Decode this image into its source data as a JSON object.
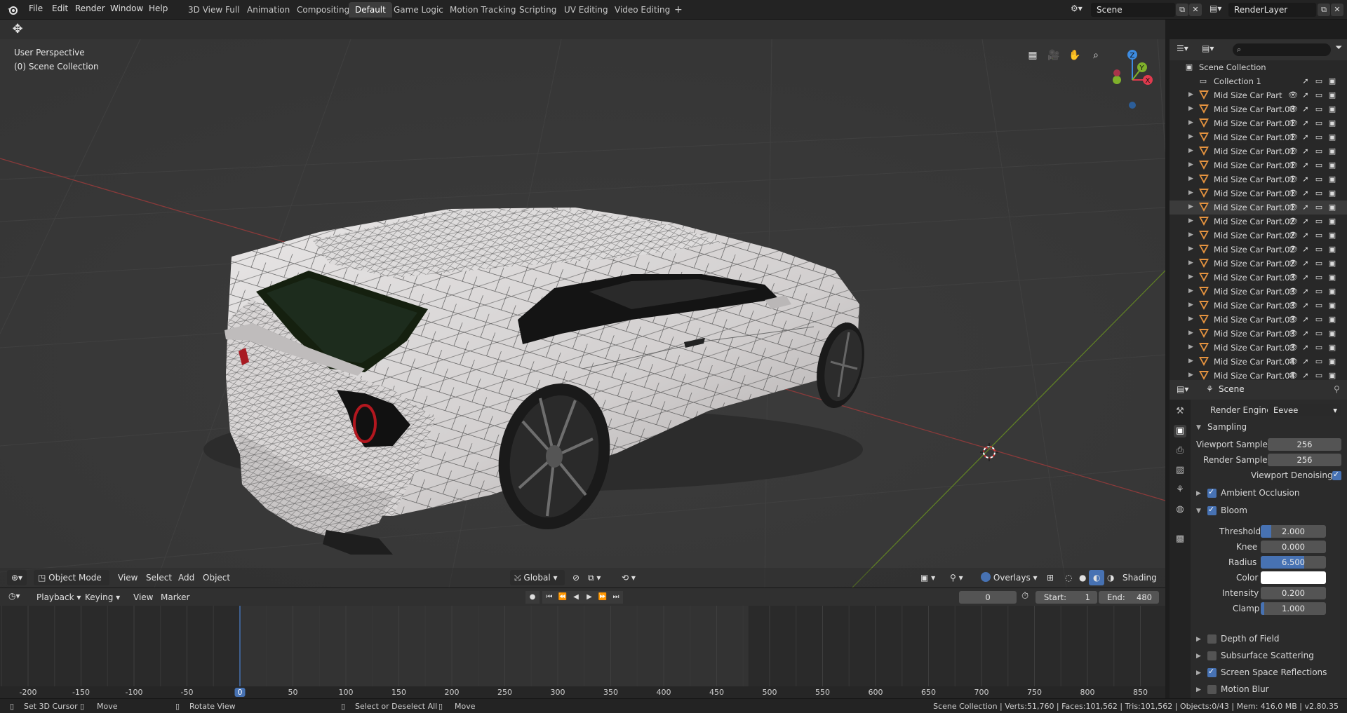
{
  "topbar": {
    "menus": [
      "File",
      "Edit",
      "Render",
      "Window",
      "Help"
    ],
    "workspaces": [
      "3D View Full",
      "Animation",
      "Compositing",
      "Default",
      "Game Logic",
      "Motion Tracking",
      "Scripting",
      "UV Editing",
      "Video Editing"
    ],
    "active_workspace": "Default",
    "add_tab": "+",
    "scene_field": "Scene",
    "layer_field": "RenderLayer"
  },
  "viewport": {
    "perspective_label": "User Perspective",
    "collection_label": "(0) Scene Collection",
    "gizmo": {
      "x": "X",
      "y": "Y",
      "z": "Z"
    },
    "header": {
      "mode": "Object Mode",
      "menus": [
        "View",
        "Select",
        "Add",
        "Object"
      ],
      "orientation": "Global",
      "overlays": "Overlays",
      "shading": "Shading"
    }
  },
  "outliner": {
    "root": "Scene Collection",
    "collection": "Collection 1",
    "items": [
      "Mid Size Car Part",
      "Mid Size Car Part.00",
      "Mid Size Car Part.01",
      "Mid Size Car Part.01",
      "Mid Size Car Part.01",
      "Mid Size Car Part.01",
      "Mid Size Car Part.01",
      "Mid Size Car Part.01",
      "Mid Size Car Part.01",
      "Mid Size Car Part.02",
      "Mid Size Car Part.02",
      "Mid Size Car Part.02",
      "Mid Size Car Part.02",
      "Mid Size Car Part.03",
      "Mid Size Car Part.03",
      "Mid Size Car Part.03",
      "Mid Size Car Part.03",
      "Mid Size Car Part.03",
      "Mid Size Car Part.03",
      "Mid Size Car Part.04",
      "Mid Size Car Part.04"
    ],
    "selected_index": 8
  },
  "properties": {
    "context": "Scene",
    "render_engine_label": "Render Engine",
    "render_engine": "Eevee",
    "sampling": "Sampling",
    "viewport_samples_label": "Viewport Samples",
    "viewport_samples": "256",
    "render_samples_label": "Render Samples",
    "render_samples": "256",
    "viewport_denoising": "Viewport Denoising",
    "ambient_occlusion": "Ambient Occlusion",
    "bloom": "Bloom",
    "threshold_label": "Threshold",
    "threshold": "2.000",
    "knee_label": "Knee",
    "knee": "0.000",
    "radius_label": "Radius",
    "radius": "6.500",
    "color_label": "Color",
    "intensity_label": "Intensity",
    "intensity": "0.200",
    "clamp_label": "Clamp",
    "clamp": "1.000",
    "depth_of_field": "Depth of Field",
    "subsurface_scattering": "Subsurface Scattering",
    "screen_space_reflections": "Screen Space Reflections",
    "motion_blur": "Motion Blur"
  },
  "timeline": {
    "menus": [
      "Playback",
      "Keying",
      "View",
      "Marker"
    ],
    "current_frame": "0",
    "start_label": "Start:",
    "start": "1",
    "end_label": "End:",
    "end": "480",
    "ticks": [
      "-200",
      "-150",
      "-100",
      "-50",
      "0",
      "50",
      "100",
      "150",
      "200",
      "250",
      "300",
      "350",
      "400",
      "450",
      "500",
      "550",
      "600",
      "650",
      "700",
      "750",
      "800",
      "850"
    ]
  },
  "statusbar": {
    "set_cursor": "Set 3D Cursor",
    "move1": "Move",
    "rotate": "Rotate View",
    "select": "Select or Deselect All",
    "move2": "Move",
    "stats": "Scene Collection | Verts:51,760 | Faces:101,562 | Tris:101,562 | Objects:0/43 | Mem: 416.0 MB | v2.80.35"
  },
  "colors": {
    "accent": "#4772b3",
    "mesh_icon": "#e5933f",
    "viewport_bg": "#393939",
    "x_axis": "#e03a4e",
    "y_axis": "#7fb02b",
    "z_axis": "#3d8be0"
  }
}
